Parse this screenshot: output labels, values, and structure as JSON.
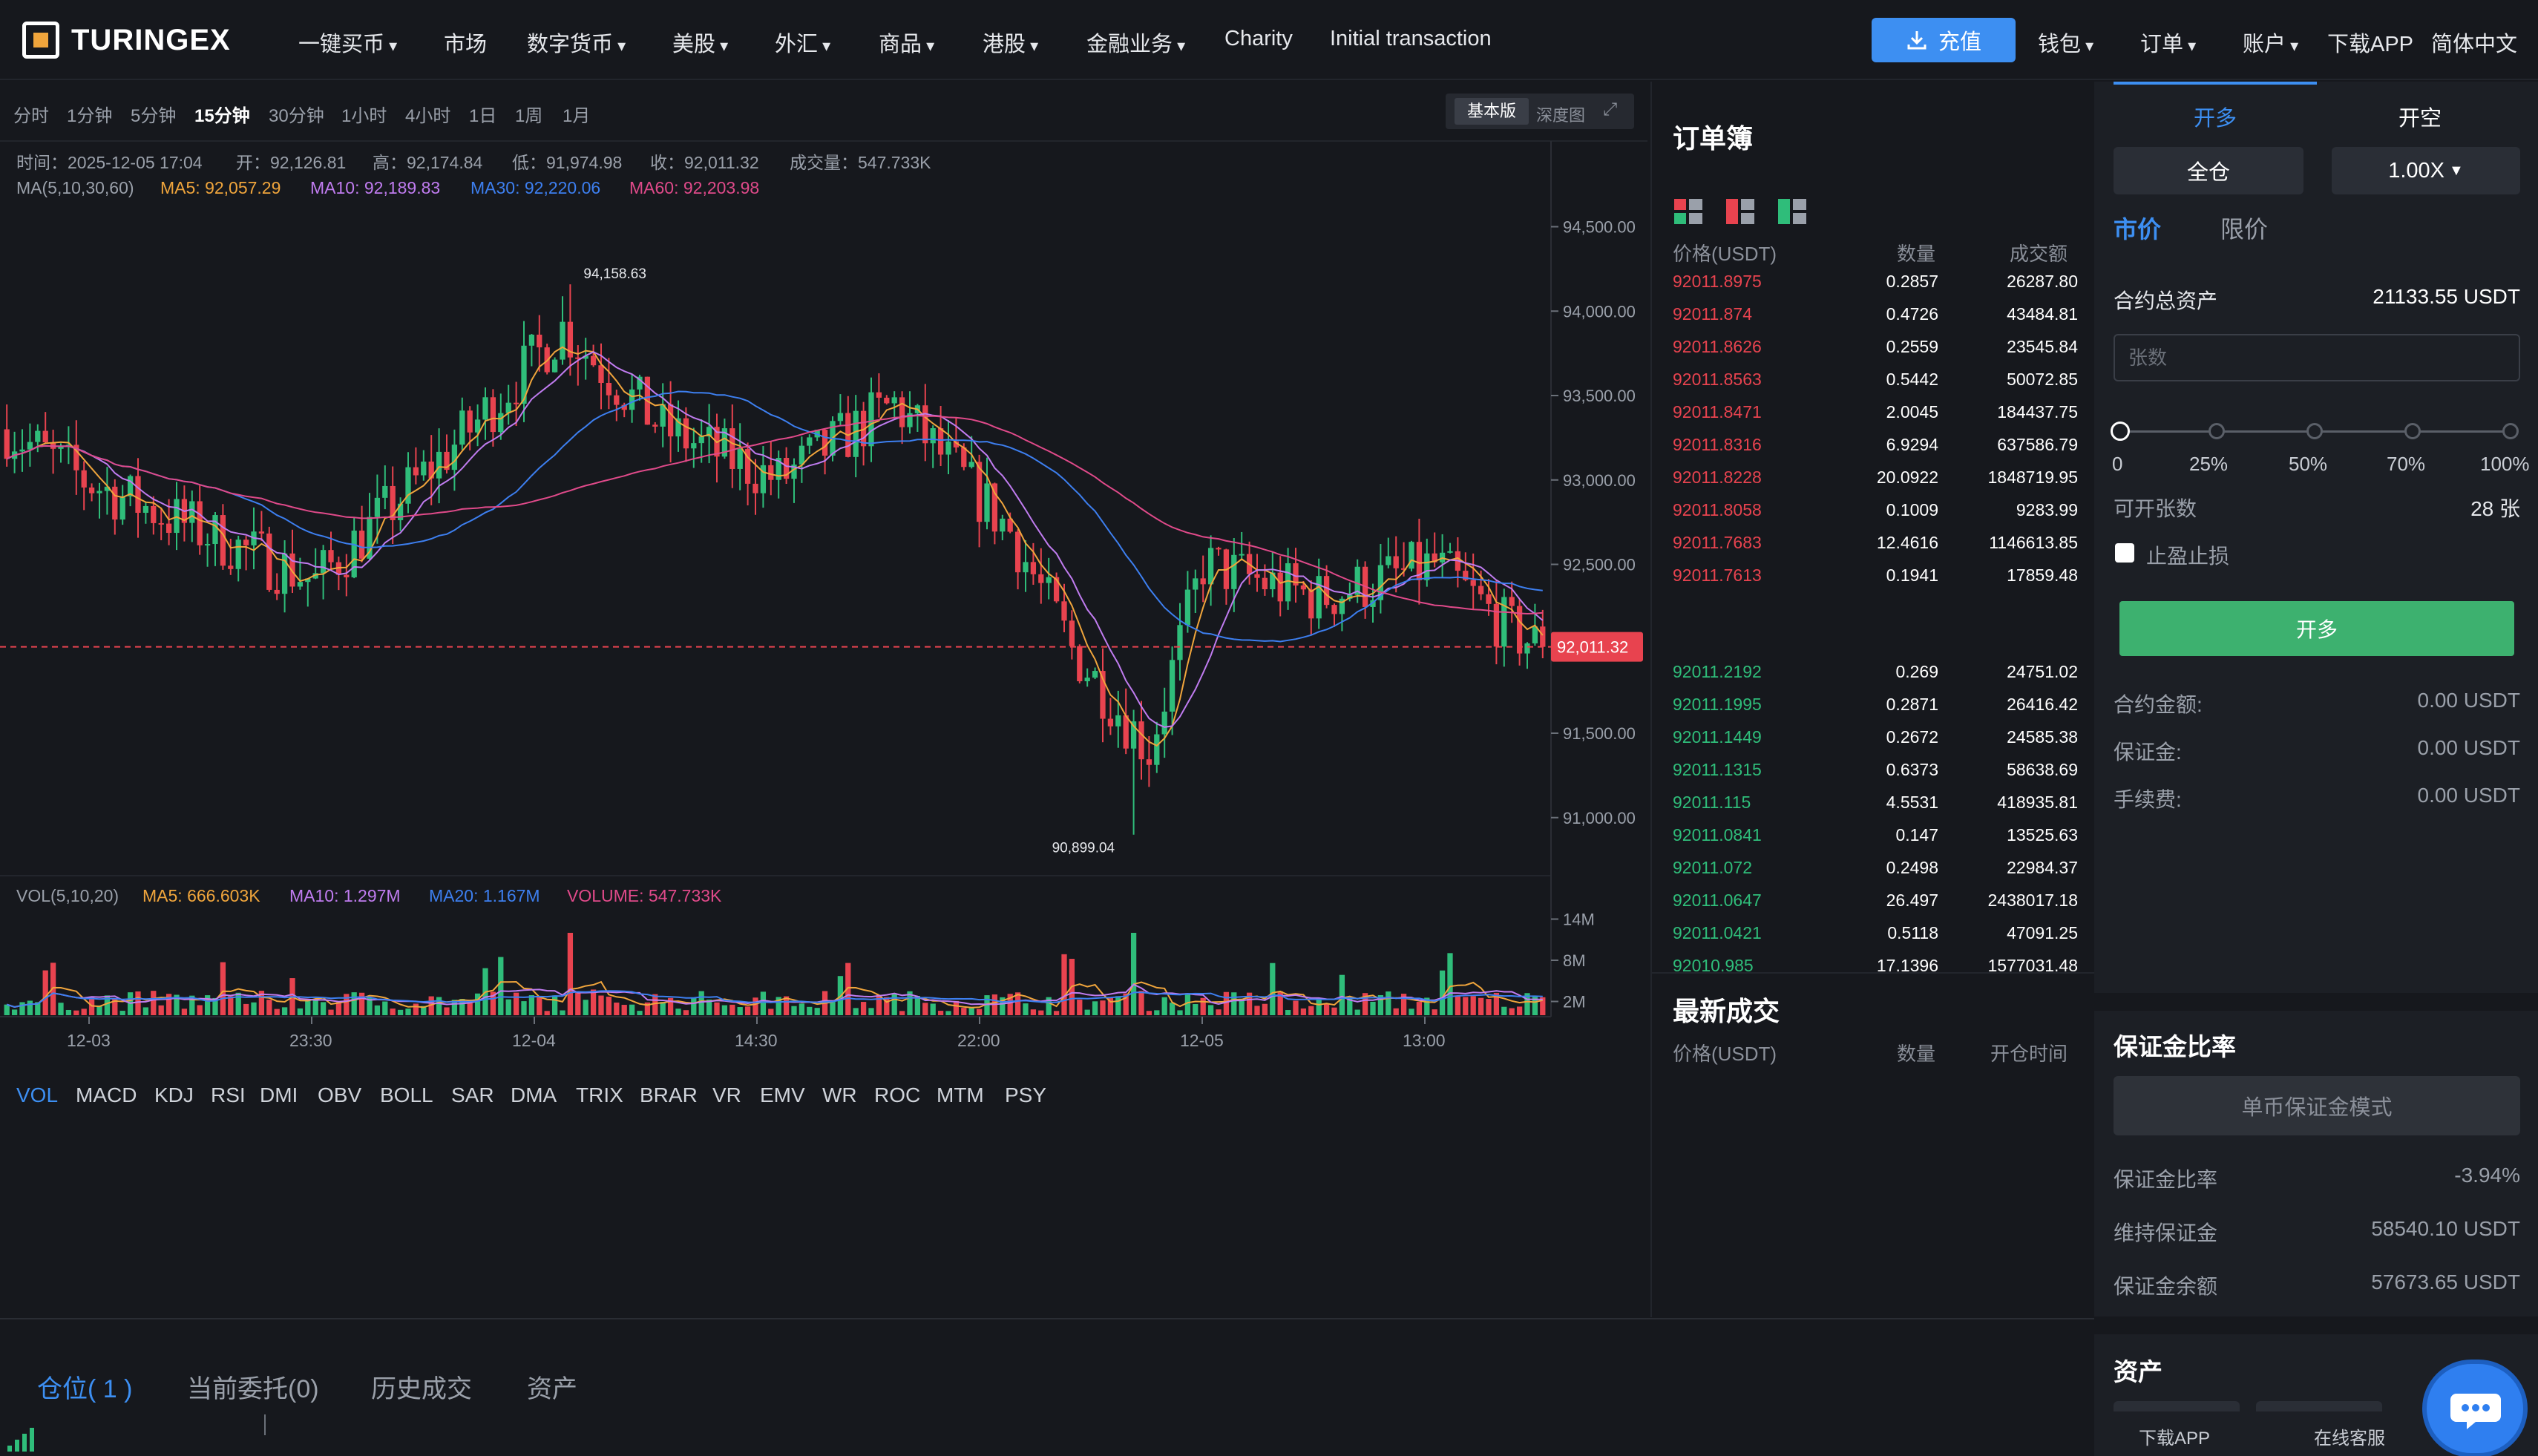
{
  "header": {
    "logo": "TURINGEX",
    "nav": [
      {
        "label": "一键买币",
        "caret": true
      },
      {
        "label": "市场",
        "caret": false
      },
      {
        "label": "数字货币",
        "caret": true
      },
      {
        "label": "美股",
        "caret": true
      },
      {
        "label": "外汇",
        "caret": true
      },
      {
        "label": "商品",
        "caret": true
      },
      {
        "label": "港股",
        "caret": true
      },
      {
        "label": "金融业务",
        "caret": true
      },
      {
        "label": "Charity",
        "caret": false
      },
      {
        "label": "Initial transaction",
        "caret": false
      }
    ],
    "recharge": "充值",
    "right_nav": [
      {
        "label": "钱包",
        "caret": true
      },
      {
        "label": "订单",
        "caret": true
      },
      {
        "label": "账户",
        "caret": true
      },
      {
        "label": "下载APP",
        "caret": false
      },
      {
        "label": "简体中文",
        "caret": false
      }
    ]
  },
  "chart": {
    "intervals": [
      "分时",
      "1分钟",
      "5分钟",
      "15分钟",
      "30分钟",
      "1小时",
      "4小时",
      "1日",
      "1周",
      "1月"
    ],
    "active_interval": "15分钟",
    "view_basic": "基本版",
    "view_depth": "深度图",
    "info": {
      "time": "时间：2025-12-05 17:04",
      "open": "开：92,126.81",
      "high": "高：92,174.84",
      "low": "低：91,974.98",
      "close": "收：92,011.32",
      "volume": "成交量：547.733K"
    },
    "ma": {
      "label": "MA(5,10,30,60)",
      "ma5": "MA5: 92,057.29",
      "ma10": "MA10: 92,189.83",
      "ma30": "MA30: 92,220.06",
      "ma60": "MA60: 92,203.98"
    },
    "vol": {
      "label": "VOL(5,10,20)",
      "ma5": "MA5: 666.603K",
      "ma10": "MA10: 1.297M",
      "ma20": "MA20: 1.167M",
      "volume": "VOLUME: 547.733K"
    },
    "indicators": [
      "VOL",
      "MACD",
      "KDJ",
      "RSI",
      "DMI",
      "OBV",
      "BOLL",
      "SAR",
      "DMA",
      "TRIX",
      "BRAR",
      "VR",
      "EMV",
      "WR",
      "ROC",
      "MTM",
      "PSY"
    ],
    "active_indicator": "VOL"
  },
  "chart_data": {
    "type": "candlestick",
    "price_axis": [
      "94,500.00",
      "94,000.00",
      "93,500.00",
      "93,000.00",
      "92,500.00",
      "92,000.00",
      "91,500.00",
      "91,000.00"
    ],
    "price_ticks": [
      94500,
      94000,
      93500,
      93000,
      92500,
      92000,
      91500,
      91000
    ],
    "ylim": [
      90700,
      94700
    ],
    "volume_axis": [
      "14M",
      "8M",
      "2M"
    ],
    "volume_ticks": [
      14,
      8,
      2
    ],
    "time_axis": [
      "12-03",
      "23:30",
      "12-04",
      "14:30",
      "22:00",
      "12-05",
      "13:00"
    ],
    "current_price": 92011.32,
    "current_price_label": "92,011.32",
    "high_annotation": "94,158.63",
    "high_value": 94158.63,
    "low_annotation": "90,899.04",
    "low_value": 90899.04,
    "colors": {
      "up": "#2fbd7a",
      "down": "#e8434f",
      "ma5": "#f0a53c",
      "ma10": "#c07cf0",
      "ma30": "#3d7ff0",
      "ma60": "#e04a8a"
    }
  },
  "orderbook": {
    "title": "订单簿",
    "headers": {
      "price": "价格(USDT)",
      "qty": "数量",
      "total": "成交额"
    },
    "asks": [
      [
        "92011.8975",
        "0.2857",
        "26287.80"
      ],
      [
        "92011.874",
        "0.4726",
        "43484.81"
      ],
      [
        "92011.8626",
        "0.2559",
        "23545.84"
      ],
      [
        "92011.8563",
        "0.5442",
        "50072.85"
      ],
      [
        "92011.8471",
        "2.0045",
        "184437.75"
      ],
      [
        "92011.8316",
        "6.9294",
        "637586.79"
      ],
      [
        "92011.8228",
        "20.0922",
        "1848719.95"
      ],
      [
        "92011.8058",
        "0.1009",
        "9283.99"
      ],
      [
        "92011.7683",
        "12.4616",
        "1146613.85"
      ],
      [
        "92011.7613",
        "0.1941",
        "17859.48"
      ]
    ],
    "bids": [
      [
        "92011.2192",
        "0.269",
        "24751.02"
      ],
      [
        "92011.1995",
        "0.2871",
        "26416.42"
      ],
      [
        "92011.1449",
        "0.2672",
        "24585.38"
      ],
      [
        "92011.1315",
        "0.6373",
        "58638.69"
      ],
      [
        "92011.115",
        "4.5531",
        "418935.81"
      ],
      [
        "92011.0841",
        "0.147",
        "13525.63"
      ],
      [
        "92011.072",
        "0.2498",
        "22984.37"
      ],
      [
        "92011.0647",
        "26.497",
        "2438017.18"
      ],
      [
        "92011.0421",
        "0.5118",
        "47091.25"
      ],
      [
        "92010.985",
        "17.1396",
        "1577031.48"
      ]
    ],
    "latest_title": "最新成交",
    "latest_headers": {
      "price": "价格(USDT)",
      "qty": "数量",
      "time": "开仓时间"
    }
  },
  "trade": {
    "tab_long": "开多",
    "tab_short": "开空",
    "margin_mode": "全仓",
    "leverage": "1.00X",
    "order_market": "市价",
    "order_limit": "限价",
    "total_assets_label": "合约总资产",
    "total_assets_value": "21133.55 USDT",
    "qty_placeholder": "张数",
    "slider_labels": [
      "0",
      "25%",
      "50%",
      "70%",
      "100%"
    ],
    "slider_value": 0,
    "available_label": "可开张数",
    "available_value": "28 张",
    "stop_label": "止盈止损",
    "open_long_btn": "开多",
    "contract_amount_label": "合约金额:",
    "contract_amount_value": "0.00 USDT",
    "margin_label": "保证金:",
    "margin_value": "0.00 USDT",
    "fee_label": "手续费:",
    "fee_value": "0.00 USDT",
    "ratio_title": "保证金比率",
    "single_mode_btn": "单币保证金模式",
    "ratio_label": "保证金比率",
    "ratio_value": "-3.94%",
    "maint_label": "维持保证金",
    "maint_value": "58540.10 USDT",
    "balance_label": "保证金余额",
    "balance_value": "57673.65 USDT",
    "assets_title": "资产"
  },
  "bottom": {
    "tabs": [
      "仓位( 1 )",
      "当前委托(0)",
      "历史成交",
      "资产"
    ],
    "footer_download": "下载APP",
    "footer_service": "在线客服"
  }
}
